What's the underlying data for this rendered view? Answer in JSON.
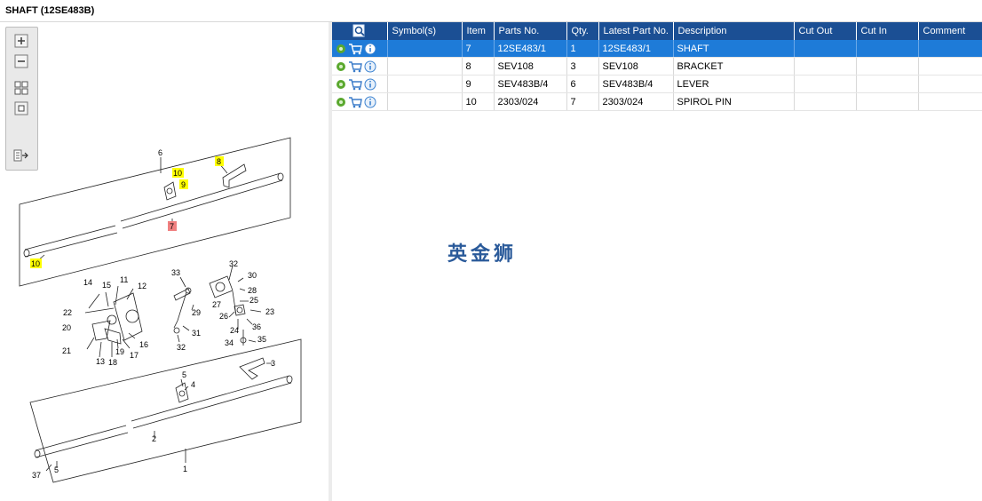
{
  "header": {
    "title": "SHAFT (12SE483B)"
  },
  "toolbox": {
    "tools": [
      "zoom-in-icon",
      "zoom-out-icon",
      "fit-all-icon",
      "actual-size-icon",
      "export-list-icon"
    ]
  },
  "diagram": {
    "callouts": {
      "c1": "1",
      "c2": "2",
      "c3": "3",
      "c4": "4",
      "c5a": "5",
      "c5b": "5",
      "c6": "6",
      "c7": "7",
      "c8": "8",
      "c9": "9",
      "c10a": "10",
      "c10b": "10",
      "c11": "11",
      "c12": "12",
      "c13": "13",
      "c14": "14",
      "c15": "15",
      "c16": "16",
      "c17": "17",
      "c18": "18",
      "c19": "19",
      "c20": "20",
      "c21": "21",
      "c22": "22",
      "c23": "23",
      "c24": "24",
      "c25": "25",
      "c26": "26",
      "c27": "27",
      "c28": "28",
      "c29": "29",
      "c30": "30",
      "c31": "31",
      "c32a": "32",
      "c32b": "32",
      "c33": "33",
      "c34": "34",
      "c35": "35",
      "c36": "36",
      "c37": "37"
    },
    "highlight_color": "#ffff00",
    "selected_color": "#f08080"
  },
  "grid": {
    "columns": {
      "icons": "",
      "symbol": "Symbol(s)",
      "item": "Item",
      "parts_no": "Parts No.",
      "qty": "Qty.",
      "latest": "Latest Part No.",
      "description": "Description",
      "cut_out": "Cut Out",
      "cut_in": "Cut In",
      "comment": "Comment"
    },
    "rows": [
      {
        "item": "7",
        "parts_no": "12SE483/1",
        "qty": "1",
        "latest": "12SE483/1",
        "description": "SHAFT",
        "selected": true
      },
      {
        "item": "8",
        "parts_no": "SEV108",
        "qty": "3",
        "latest": "SEV108",
        "description": "BRACKET",
        "selected": false
      },
      {
        "item": "9",
        "parts_no": "SEV483B/4",
        "qty": "6",
        "latest": "SEV483B/4",
        "description": "LEVER",
        "selected": false
      },
      {
        "item": "10",
        "parts_no": "2303/024",
        "qty": "7",
        "latest": "2303/024",
        "description": "SPIROL PIN",
        "selected": false
      }
    ]
  },
  "watermark": "英金狮",
  "colors": {
    "header_bg": "#1b4f94",
    "selected_row": "#1e7bd8"
  }
}
